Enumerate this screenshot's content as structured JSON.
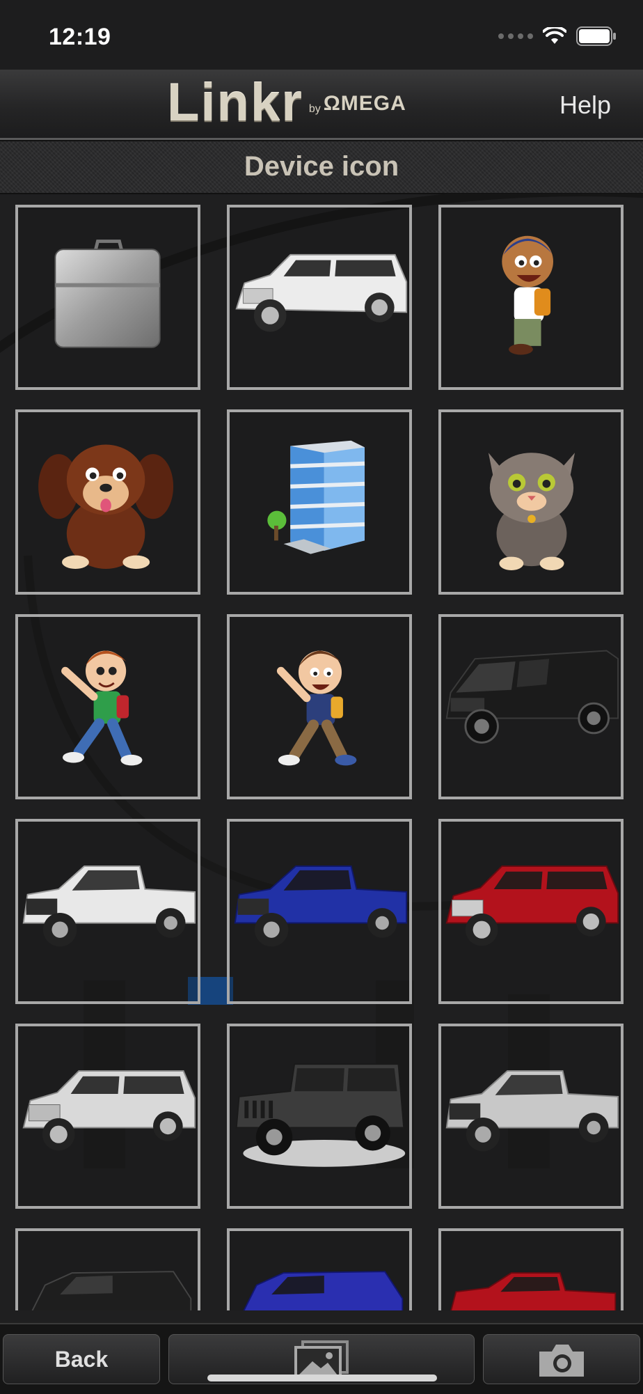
{
  "status_bar": {
    "time": "12:19"
  },
  "header": {
    "logo_main": "Linkr",
    "logo_by": "by",
    "logo_brand": "ΩMEGA",
    "help_label": "Help"
  },
  "page": {
    "title": "Device icon"
  },
  "icons": [
    "briefcase-icon",
    "white-suv-icon",
    "cartoon-boy-icon",
    "cartoon-dog-icon",
    "office-building-icon",
    "cartoon-cat-icon",
    "boy-green-shirt-icon",
    "boy-blue-shirt-icon",
    "black-van-icon",
    "white-pickup-icon",
    "blue-pickup-icon",
    "red-suv-icon",
    "silver-suv-icon",
    "gray-jeep-icon",
    "silver-pickup-icon",
    "black-suv-icon",
    "blue-suv-icon",
    "red-pickup-icon"
  ],
  "toolbar": {
    "back_label": "Back",
    "gallery_icon": "photo-gallery-icon",
    "camera_icon": "camera-icon"
  },
  "colors": {
    "tile_border": "#a8a8a8",
    "background": "#1f1f20",
    "logo": "#d8d2c2"
  }
}
